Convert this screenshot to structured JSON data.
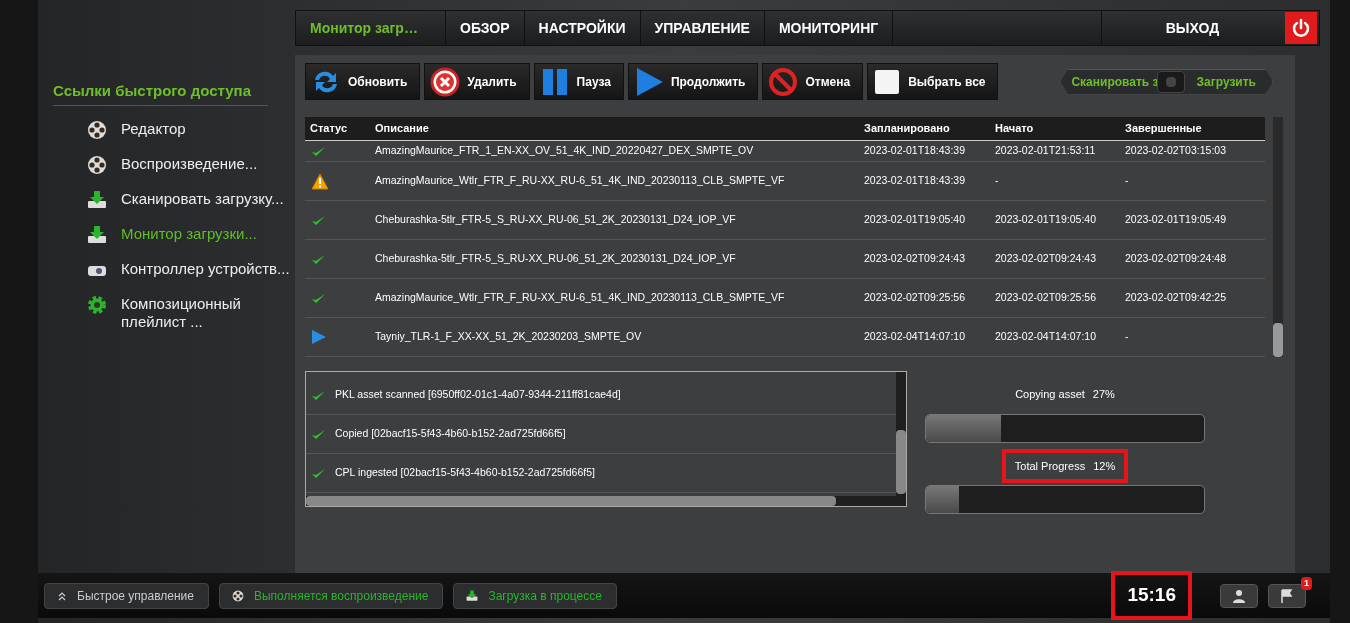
{
  "nav": {
    "items": [
      {
        "label": "Монитор загр…",
        "selected": true
      },
      {
        "label": "ОБЗОР",
        "selected": false
      },
      {
        "label": "НАСТРОЙКИ",
        "selected": false
      },
      {
        "label": "УПРАВЛЕНИЕ",
        "selected": false
      },
      {
        "label": "МОНИТОРИНГ",
        "selected": false
      }
    ],
    "exit": "ВЫХОД"
  },
  "sidebar": {
    "title": "Ссылки быстрого доступа",
    "items": [
      {
        "label": "Редактор",
        "kind": "reel",
        "selected": false
      },
      {
        "label": "Воспроизведение...",
        "kind": "reel",
        "selected": false
      },
      {
        "label": "Сканировать загрузку...",
        "kind": "download",
        "selected": false
      },
      {
        "label": "Монитор загрузки...",
        "kind": "download",
        "selected": true
      },
      {
        "label": "Контроллер устройств...",
        "kind": "projector",
        "selected": false
      },
      {
        "label": "Композиционный плейлист ...",
        "kind": "gear",
        "selected": false
      }
    ]
  },
  "toolbar": [
    {
      "label": "Обновить",
      "kind": "refresh"
    },
    {
      "label": "Удалить",
      "kind": "delete"
    },
    {
      "label": "Пауза",
      "kind": "pause"
    },
    {
      "label": "Продолжить",
      "kind": "play"
    },
    {
      "label": "Отмена",
      "kind": "cancel"
    },
    {
      "label": "Выбрать все",
      "kind": "checkbox"
    }
  ],
  "switch": {
    "left": "Сканировать з",
    "right": "Загрузить",
    "on": false
  },
  "table": {
    "columns": [
      "Статус",
      "Описание",
      "Запланировано",
      "Начато",
      "Завершенные"
    ],
    "rows": [
      {
        "kind": "ok",
        "description": "AmazingMaurice_FTR_1_EN-XX_OV_51_4K_IND_20220427_DEX_SMPTE_OV",
        "scheduled": "2023-02-01T18:43:39",
        "started": "2023-02-01T21:53:11",
        "finished": "2023-02-02T03:15:03"
      },
      {
        "kind": "warning",
        "description": "AmazingMaurice_Wtlr_FTR_F_RU-XX_RU-6_51_4K_IND_20230113_CLB_SMPTE_VF",
        "scheduled": "2023-02-01T18:43:39",
        "started": "-",
        "finished": "-"
      },
      {
        "kind": "ok",
        "description": "Cheburashka-5tlr_FTR-5_S_RU-XX_RU-06_51_2K_20230131_D24_IOP_VF",
        "scheduled": "2023-02-01T19:05:40",
        "started": "2023-02-01T19:05:40",
        "finished": "2023-02-01T19:05:49"
      },
      {
        "kind": "ok",
        "description": "Cheburashka-5tlr_FTR-5_S_RU-XX_RU-06_51_2K_20230131_D24_IOP_VF",
        "scheduled": "2023-02-02T09:24:43",
        "started": "2023-02-02T09:24:43",
        "finished": "2023-02-02T09:24:48"
      },
      {
        "kind": "ok",
        "description": "AmazingMaurice_Wtlr_FTR_F_RU-XX_RU-6_51_4K_IND_20230113_CLB_SMPTE_VF",
        "scheduled": "2023-02-02T09:25:56",
        "started": "2023-02-02T09:25:56",
        "finished": "2023-02-02T09:42:25"
      },
      {
        "kind": "playing",
        "description": "Tayniy_TLR-1_F_XX-XX_51_2K_20230203_SMPTE_OV",
        "scheduled": "2023-02-04T14:07:10",
        "started": "2023-02-04T14:07:10",
        "finished": "-"
      }
    ]
  },
  "log": [
    {
      "kind": "ok",
      "text": "PKL asset scanned [6950ff02-01c1-4a07-9344-211ff81cae4d]"
    },
    {
      "kind": "ok",
      "text": "Copied [02bacf15-5f43-4b60-b152-2ad725fd66f5]"
    },
    {
      "kind": "ok",
      "text": "CPL ingested [02bacf15-5f43-4b60-b152-2ad725fd66f5]"
    }
  ],
  "progress": [
    {
      "label": "Copying asset",
      "value": "27%",
      "level": 0.27,
      "highlighted": false
    },
    {
      "label": "Total Progress",
      "value": "12%",
      "level": 0.12,
      "highlighted": true
    }
  ],
  "bottom_bar": {
    "buttons": [
      {
        "label": "Быстрое управление",
        "kind": "chevrons",
        "active": false
      },
      {
        "label": "Выполняется воспроизведение",
        "kind": "reel",
        "active": true
      },
      {
        "label": "Загрузка в процессе",
        "kind": "download",
        "active": true
      }
    ],
    "clock": "15:16",
    "clock_highlighted": true,
    "notifications": "1"
  }
}
